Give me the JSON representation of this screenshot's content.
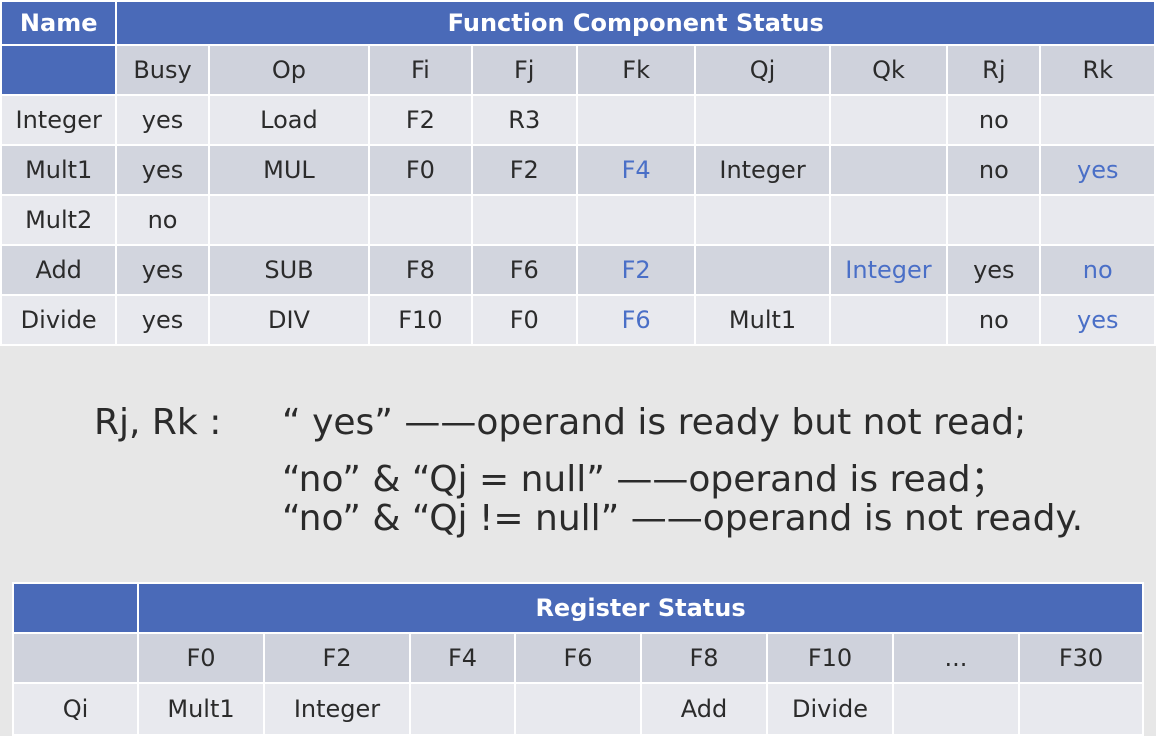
{
  "function_status": {
    "name_header": "Name",
    "title": "Function Component Status",
    "columns": [
      "Busy",
      "Op",
      "Fi",
      "Fj",
      "Fk",
      "Qj",
      "Qk",
      "Rj",
      "Rk"
    ],
    "rows": [
      {
        "name": "Integer",
        "cells": [
          "yes",
          "Load",
          "F2",
          "R3",
          "",
          "",
          "",
          "no",
          ""
        ]
      },
      {
        "name": "Mult1",
        "cells": [
          "yes",
          "MUL",
          "F0",
          "F2",
          "F4",
          "Integer",
          "",
          "no",
          "yes"
        ]
      },
      {
        "name": "Mult2",
        "cells": [
          "no",
          "",
          "",
          "",
          "",
          "",
          "",
          "",
          ""
        ]
      },
      {
        "name": "Add",
        "cells": [
          "yes",
          "SUB",
          "F8",
          "F6",
          "F2",
          "",
          "Integer",
          "yes",
          "no"
        ]
      },
      {
        "name": "Divide",
        "cells": [
          "yes",
          "DIV",
          "F10",
          "F0",
          "F6",
          "Mult1",
          "",
          "no",
          "yes"
        ]
      }
    ],
    "highlight_color": "#4a6fc7",
    "header_color": "#4a6ab8"
  },
  "legend": {
    "term": "Rj, Rk :",
    "lines": [
      "“ yes” ——operand is ready but not read;",
      "“no” & “Qj   = null” ——operand is read；",
      "“no” & “Qj  != null” ——operand is not ready."
    ]
  },
  "register_status": {
    "title": "Register Status",
    "columns": [
      "F0",
      "F2",
      "F4",
      "F6",
      "F8",
      "F10",
      "...",
      "F30"
    ],
    "row_label": "Qi",
    "values": [
      "Mult1",
      "Integer",
      "",
      "",
      "Add",
      "Divide",
      "",
      ""
    ]
  }
}
